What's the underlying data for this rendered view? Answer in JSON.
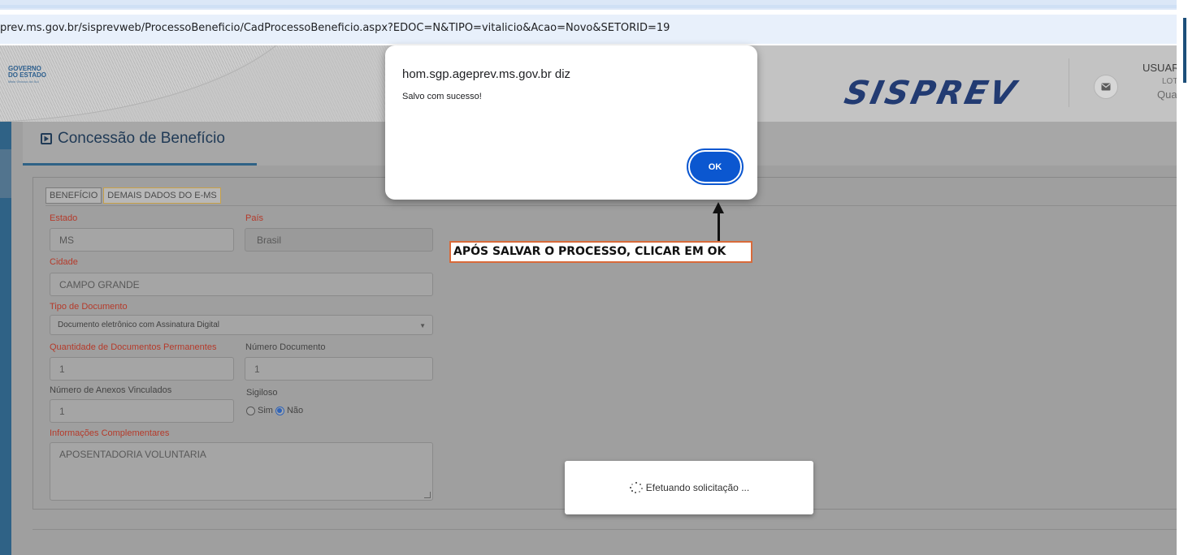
{
  "browser": {
    "url": "prev.ms.gov.br/sisprevweb/ProcessoBeneficio/CadProcessoBeneficio.aspx?EDOC=N&TIPO=vitalicio&Acao=Novo&SETORID=19"
  },
  "header": {
    "logo": {
      "line1": "GOVERNO",
      "line2": "DO ESTADO",
      "line3": "Mato Grosso do Sul"
    },
    "brand": "SISPREV",
    "user_label": "USUARIO",
    "user_lot": "LOT",
    "user_qua": "Qua"
  },
  "page": {
    "title": "Concessão de Benefício",
    "tabs": [
      {
        "label": "BENEFÍCIO",
        "active": false
      },
      {
        "label": "DEMAIS DADOS DO E-MS",
        "active": true
      }
    ]
  },
  "form": {
    "estado_label": "Estado",
    "estado_value": "MS",
    "pais_label": "País",
    "pais_value": "Brasil",
    "cidade_label": "Cidade",
    "cidade_value": "CAMPO GRANDE",
    "tipo_doc_label": "Tipo de Documento",
    "tipo_doc_value": "Documento eletrônico com Assinatura Digital",
    "qtd_docs_label": "Quantidade de Documentos Permanentes",
    "qtd_docs_value": "1",
    "num_doc_label": "Número Documento",
    "num_doc_value": "1",
    "anexos_label": "Número de Anexos Vinculados",
    "anexos_value": "1",
    "sigiloso_label": "Sigiloso",
    "sigiloso_sim": "Sim",
    "sigiloso_nao": "Não",
    "sigiloso_selected": "Não",
    "info_label": "Informações Complementares",
    "info_value": "APOSENTADORIA VOLUNTARIA"
  },
  "dialog": {
    "origin": "hom.sgp.ageprev.ms.gov.br diz",
    "message": "Salvo com sucesso!",
    "ok_label": "OK"
  },
  "annotation": {
    "text": "APÓS SALVAR O PROCESSO, CLICAR EM OK"
  },
  "loading": {
    "text": "Efetuando solicitação ..."
  },
  "colors": {
    "accent": "#0b57d0",
    "rail": "#2f6286",
    "required_label": "#b53a2a",
    "callout_border": "#d86a3a"
  }
}
